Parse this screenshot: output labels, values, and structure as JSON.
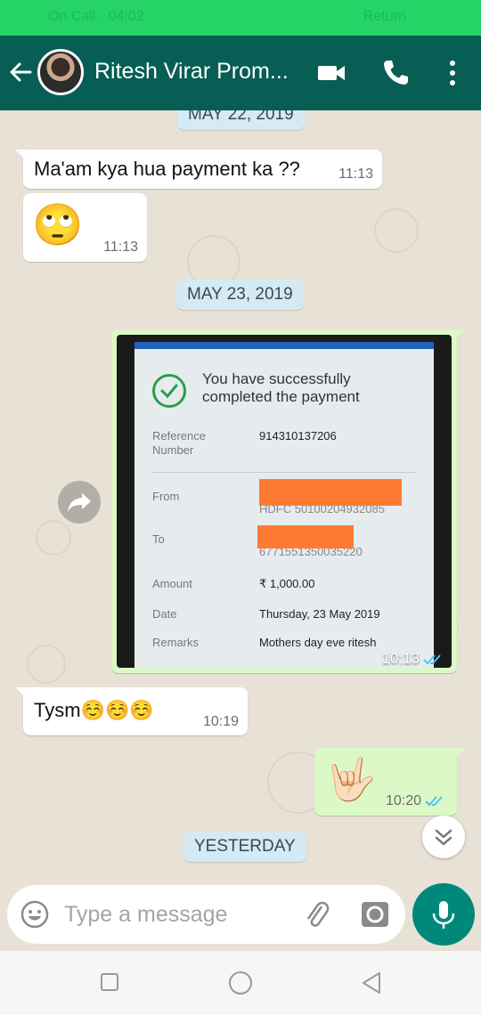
{
  "status_bar": {
    "call_text": "On Call · 04:02",
    "return_text": "Return"
  },
  "header": {
    "contact_name": "Ritesh Virar Prom...",
    "icons": [
      "back-arrow-icon",
      "video-call-icon",
      "phone-icon",
      "more-vert-icon"
    ]
  },
  "messages": {
    "date_may22": "MAY 22, 2019",
    "msg1": {
      "text": "Ma'am kya hua payment ka ??",
      "time": "11:13"
    },
    "msg2": {
      "emoji": "🙄",
      "time": "11:13"
    },
    "date_may23": "MAY 23, 2019",
    "image_msg": {
      "time": "10:13",
      "screenshot": {
        "title": "You have successfully completed the payment",
        "reference_label": "Reference Number",
        "reference_value": "914310137206",
        "from_label": "From",
        "from_value": "HDFC 50100204932085",
        "to_label": "To",
        "to_value": "6771551350035220",
        "amount_label": "Amount",
        "amount_value": "₹ 1,000.00",
        "date_label": "Date",
        "date_value": "Thursday, 23 May 2019",
        "remarks_label": "Remarks",
        "remarks_value": "Mothers day eve ritesh"
      }
    },
    "msg3": {
      "text": "Tysm☺️☺️☺️",
      "time": "10:19"
    },
    "msg4": {
      "emoji": "🤟🏻",
      "time": "10:20"
    },
    "date_yesterday": "YESTERDAY"
  },
  "composer": {
    "placeholder": "Type a message",
    "icons": [
      "emoji-icon",
      "attach-icon",
      "camera-icon",
      "mic-icon"
    ]
  },
  "colors": {
    "status_bar": "#25d366",
    "header": "#075e54",
    "outgoing_bubble": "#dcf8c6",
    "incoming_bubble": "#ffffff",
    "date_chip": "#d4eaf4",
    "mic_button": "#00897b",
    "read_ticks": "#4fc3f7",
    "redaction": "#ff7a33"
  }
}
